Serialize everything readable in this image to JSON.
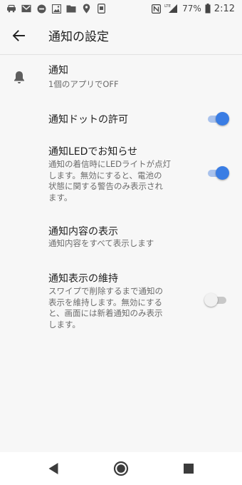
{
  "status_bar": {
    "battery_percent": "77%",
    "time": "2:12",
    "network_badge": "LTE",
    "left_icons": [
      "car-icon",
      "mail-icon",
      "do-not-disturb-icon",
      "image-icon",
      "folder-icon",
      "location-icon",
      "app-icon"
    ],
    "right_icons": [
      "nfc-icon",
      "signal-icon",
      "battery-icon"
    ]
  },
  "app_bar": {
    "back_icon": "arrow-back-icon",
    "title": "通知の設定"
  },
  "settings": [
    {
      "title": "通知",
      "subtitle": "1個のアプリでOFF",
      "icon": "bell-icon"
    },
    {
      "title": "通知ドットの許可",
      "toggle": true
    },
    {
      "title": "通知LEDでお知らせ",
      "subtitle_lines": [
        "通知の着信時にLEDライトが点灯",
        "します。無効にすると、電池の",
        "状態に関する警告のみ表示され",
        "ます。"
      ],
      "toggle": true
    },
    {
      "title": "通知内容の表示",
      "subtitle": "通知内容をすべて表示します"
    },
    {
      "title": "通知表示の維持",
      "subtitle_lines": [
        "スワイプで削除するまで通知の",
        "表示を維持します。無効にする",
        "と、画面には新着通知のみ表示",
        "します。"
      ],
      "toggle": false
    }
  ],
  "nav_bar": {
    "back": "nav-back-icon",
    "home": "nav-home-icon",
    "recents": "nav-recents-icon"
  },
  "colors": {
    "accent": "#3a7de4",
    "accent_track": "#a9c2ec",
    "background": "#f7f7f7"
  }
}
